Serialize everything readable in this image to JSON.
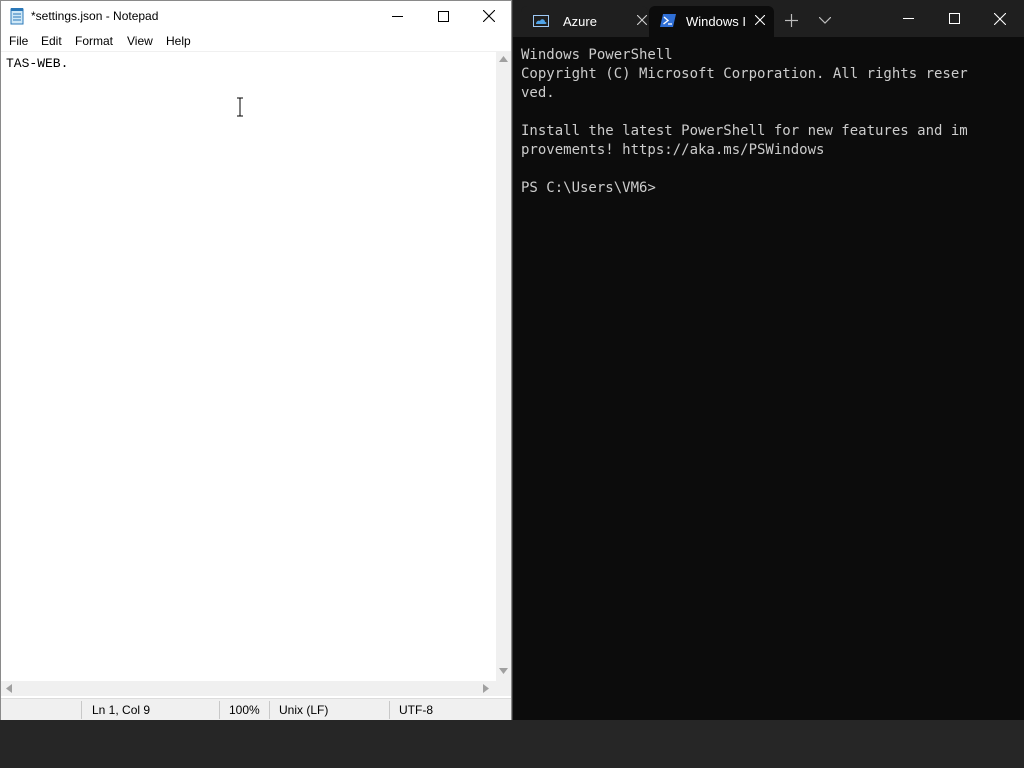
{
  "notepad": {
    "title": "*settings.json - Notepad",
    "menu": [
      "File",
      "Edit",
      "Format",
      "View",
      "Help"
    ],
    "content": "TAS-WEB.",
    "status": {
      "position": "Ln 1, Col 9",
      "zoom": "100%",
      "line_ending": "Unix (LF)",
      "encoding": "UTF-8"
    }
  },
  "terminal": {
    "tabs": [
      {
        "label": "Azure",
        "icon": "azure-cloud-shell-icon",
        "active": false
      },
      {
        "label": "Windows I",
        "icon": "powershell-icon",
        "active": true
      }
    ],
    "lines": [
      "Windows PowerShell",
      "Copyright (C) Microsoft Corporation. All rights reser",
      "ved.",
      "",
      "Install the latest PowerShell for new features and im",
      "provements! https://aka.ms/PSWindows",
      "",
      "PS C:\\Users\\VM6>"
    ]
  },
  "colors": {
    "terminal_bg": "#0c0c0c",
    "terminal_text": "#cccccc",
    "tabbar_bg": "#1f1f1f",
    "taskbar_bg": "#262626"
  }
}
